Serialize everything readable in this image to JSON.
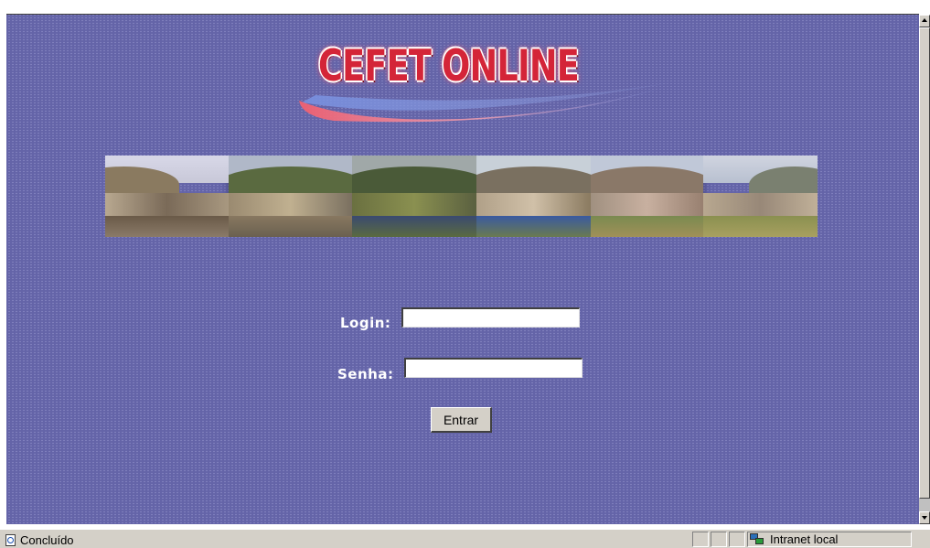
{
  "page": {
    "logo_text": "CEFET ONLINE",
    "accent_color": "#6464a8"
  },
  "form": {
    "login_label": "Login:",
    "login_value": "",
    "senha_label": "Senha:",
    "senha_value": "",
    "submit_label": "Entrar"
  },
  "statusbar": {
    "status_text": "Concluído",
    "zone_text": "Intranet local",
    "status_icon": "page-done-icon",
    "zone_icon": "intranet-icon"
  }
}
